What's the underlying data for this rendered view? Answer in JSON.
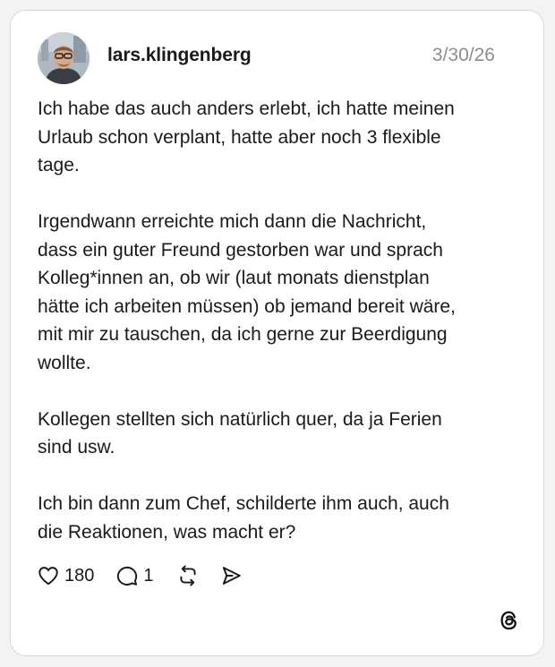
{
  "post": {
    "username": "lars.klingenberg",
    "date": "3/30/26",
    "paragraphs": [
      "Ich habe das auch anders erlebt, ich hatte meinen\nUrlaub schon verplant, hatte aber noch 3 flexible\ntage.",
      "Irgendwann erreichte mich dann die Nachricht,\ndass ein guter Freund gestorben war und sprach\nKolleg*innen an, ob wir (laut monats dienstplan\nhätte ich arbeiten müssen) ob jemand bereit wäre,\nmit mir zu tauschen, da ich gerne zur Beerdigung\nwollte.",
      "Kollegen stellten sich natürlich quer, da ja Ferien\nsind usw.",
      "Ich bin dann zum Chef, schilderte ihm auch, auch\ndie Reaktionen, was macht er?"
    ]
  },
  "actions": {
    "like_icon": "heart-outline-icon",
    "like_count": "180",
    "reply_icon": "speech-bubble-icon",
    "reply_count": "1",
    "repost_icon": "repost-arrows-icon",
    "share_icon": "send-paper-plane-icon"
  },
  "branding": {
    "logo_icon": "threads-logo-icon"
  },
  "colors": {
    "text": "#1a1a1a",
    "muted": "#8e8e8e",
    "card_border": "#d9d9d9",
    "background": "#f3f3f3"
  }
}
